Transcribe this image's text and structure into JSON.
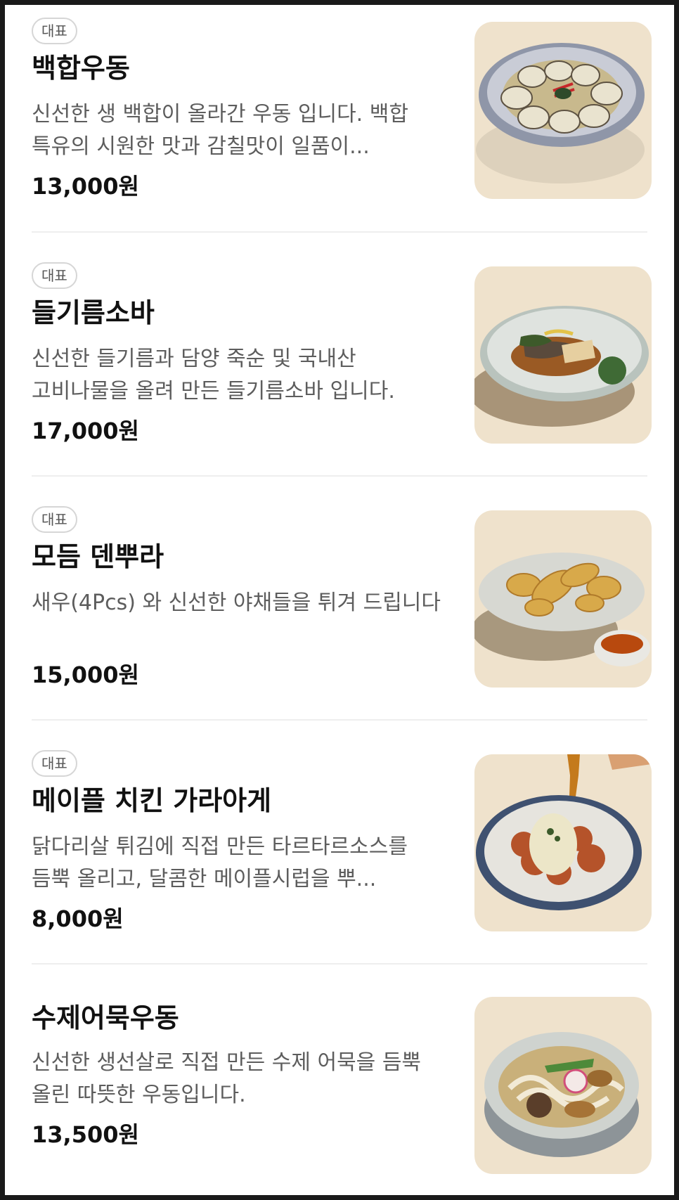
{
  "menu": {
    "items": [
      {
        "badge": "대표",
        "name": "백합우동",
        "description": "신선한 생 백합이 올라간 우동 입니다. 백합 특유의 시원한 맛과 감칠맛이 일품이...",
        "price": "13,000원",
        "image_icon": "clam-udon-photo"
      },
      {
        "badge": "대표",
        "name": "들기름소바",
        "description": "신선한 들기름과 담양 죽순 및 국내산 고비나물을 올려 만든 들기름소바 입니다.",
        "price": "17,000원",
        "image_icon": "perilla-soba-photo"
      },
      {
        "badge": "대표",
        "name": "모듬 덴뿌라",
        "description": "새우(4Pcs) 와 신선한 야채들을 튀겨 드립니다",
        "price": "15,000원",
        "image_icon": "tempura-photo"
      },
      {
        "badge": "대표",
        "name": "메이플 치킨 가라아게",
        "description": "닭다리살 튀김에 직접 만든 타르타르소스를 듬뿍 올리고, 달콤한 메이플시럽을 뿌...",
        "price": "8,000원",
        "image_icon": "karaage-photo"
      },
      {
        "name": "수제어묵우동",
        "description": "신선한 생선살로 직접 만든 수제 어묵을 듬뿍 올린 따뜻한 우동입니다.",
        "price": "13,500원",
        "image_icon": "fishcake-udon-photo"
      }
    ]
  }
}
